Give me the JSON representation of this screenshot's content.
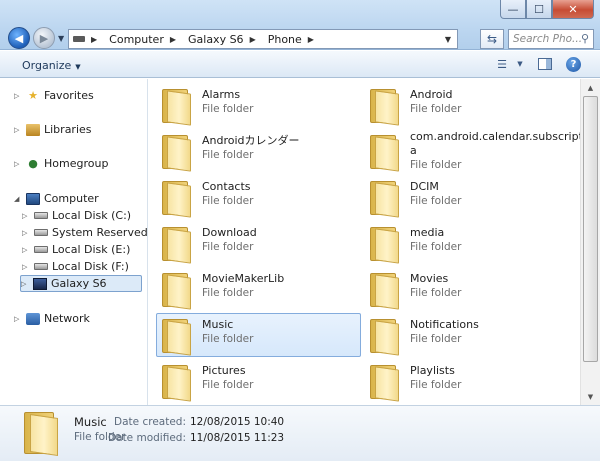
{
  "window": {
    "controls": {
      "minimize": "—",
      "maximize": "☐",
      "close": "✕"
    }
  },
  "address": {
    "crumbs": [
      "Computer",
      "Galaxy S6",
      "Phone"
    ],
    "search_placeholder": "Search Pho..."
  },
  "toolbar": {
    "organize_label": "Organize"
  },
  "navpane": {
    "favorites": "Favorites",
    "libraries": "Libraries",
    "homegroup": "Homegroup",
    "computer": "Computer",
    "drives": [
      "Local Disk (C:)",
      "System Reserved (D:)",
      "Local Disk (E:)",
      "Local Disk (F:)"
    ],
    "device": "Galaxy S6",
    "network": "Network"
  },
  "folders": [
    {
      "name": "Alarms",
      "type": "File folder"
    },
    {
      "name": "Android",
      "type": "File folder"
    },
    {
      "name": "Androidカレンダー",
      "type": "File folder"
    },
    {
      "name": "com.android.calendar.subscription.",
      "name2": "a",
      "type": "File folder"
    },
    {
      "name": "Contacts",
      "type": "File folder"
    },
    {
      "name": "DCIM",
      "type": "File folder"
    },
    {
      "name": "Download",
      "type": "File folder"
    },
    {
      "name": "media",
      "type": "File folder"
    },
    {
      "name": "MovieMakerLib",
      "type": "File folder"
    },
    {
      "name": "Movies",
      "type": "File folder"
    },
    {
      "name": "Music",
      "type": "File folder"
    },
    {
      "name": "Notifications",
      "type": "File folder"
    },
    {
      "name": "Pictures",
      "type": "File folder"
    },
    {
      "name": "Playlists",
      "type": "File folder"
    }
  ],
  "details": {
    "name": "Music",
    "type": "File folder",
    "created_label": "Date created:",
    "created_value": "12/08/2015 10:40",
    "modified_label": "Date modified:",
    "modified_value": "11/08/2015 11:23"
  }
}
